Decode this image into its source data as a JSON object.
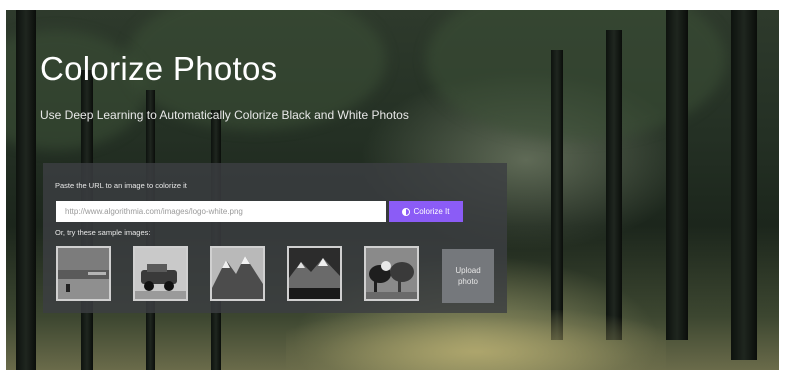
{
  "hero": {
    "title": "Colorize Photos",
    "subtitle": "Use Deep Learning to Automatically Colorize Black and White Photos"
  },
  "form": {
    "url_label": "Paste the URL to an image to colorize it",
    "url_value": "http://www.algorithmia.com/images/logo-white.png",
    "colorize_label": "Colorize It",
    "colorize_icon": "half-circle-icon",
    "samples_label": "Or, try these sample images:",
    "upload_label": "Upload photo"
  },
  "colors": {
    "accent": "#8b5cf6",
    "panel": "#3c3e42",
    "upload_button": "#75787c"
  }
}
